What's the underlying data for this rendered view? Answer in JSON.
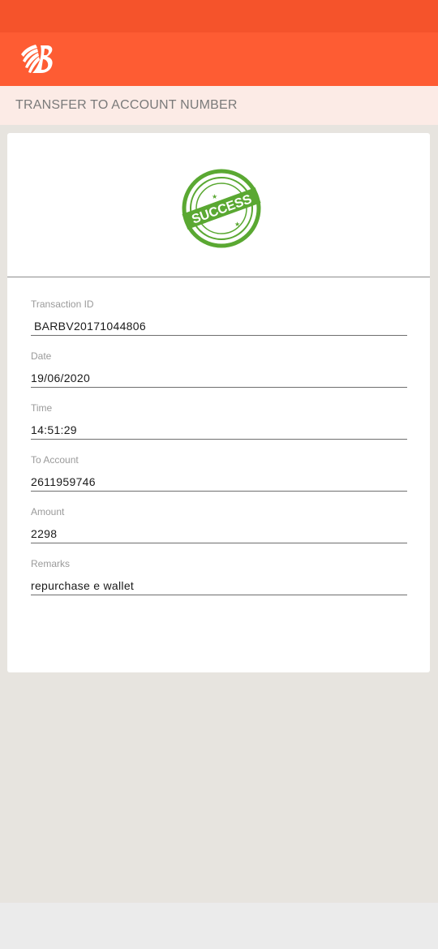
{
  "header": {
    "logo_icon": "bank-of-baroda-logo"
  },
  "subheader": {
    "title": "TRANSFER TO ACCOUNT NUMBER"
  },
  "stamp": {
    "text": "SUCCESS",
    "icon": "success-stamp-icon",
    "color": "#5aa832"
  },
  "fields": [
    {
      "label": "Transaction ID",
      "value": "BARBV20171044806"
    },
    {
      "label": "Date",
      "value": "19/06/2020"
    },
    {
      "label": "Time",
      "value": "14:51:29"
    },
    {
      "label": "To Account",
      "value": "2611959746"
    },
    {
      "label": "Amount",
      "value": "2298"
    },
    {
      "label": "Remarks",
      "value": "repurchase e wallet"
    }
  ],
  "colors": {
    "status_bar": "#f5532b",
    "app_bar": "#fe5c33",
    "subheader_bg": "#fcebe6",
    "page_bg": "#e7e4df"
  }
}
